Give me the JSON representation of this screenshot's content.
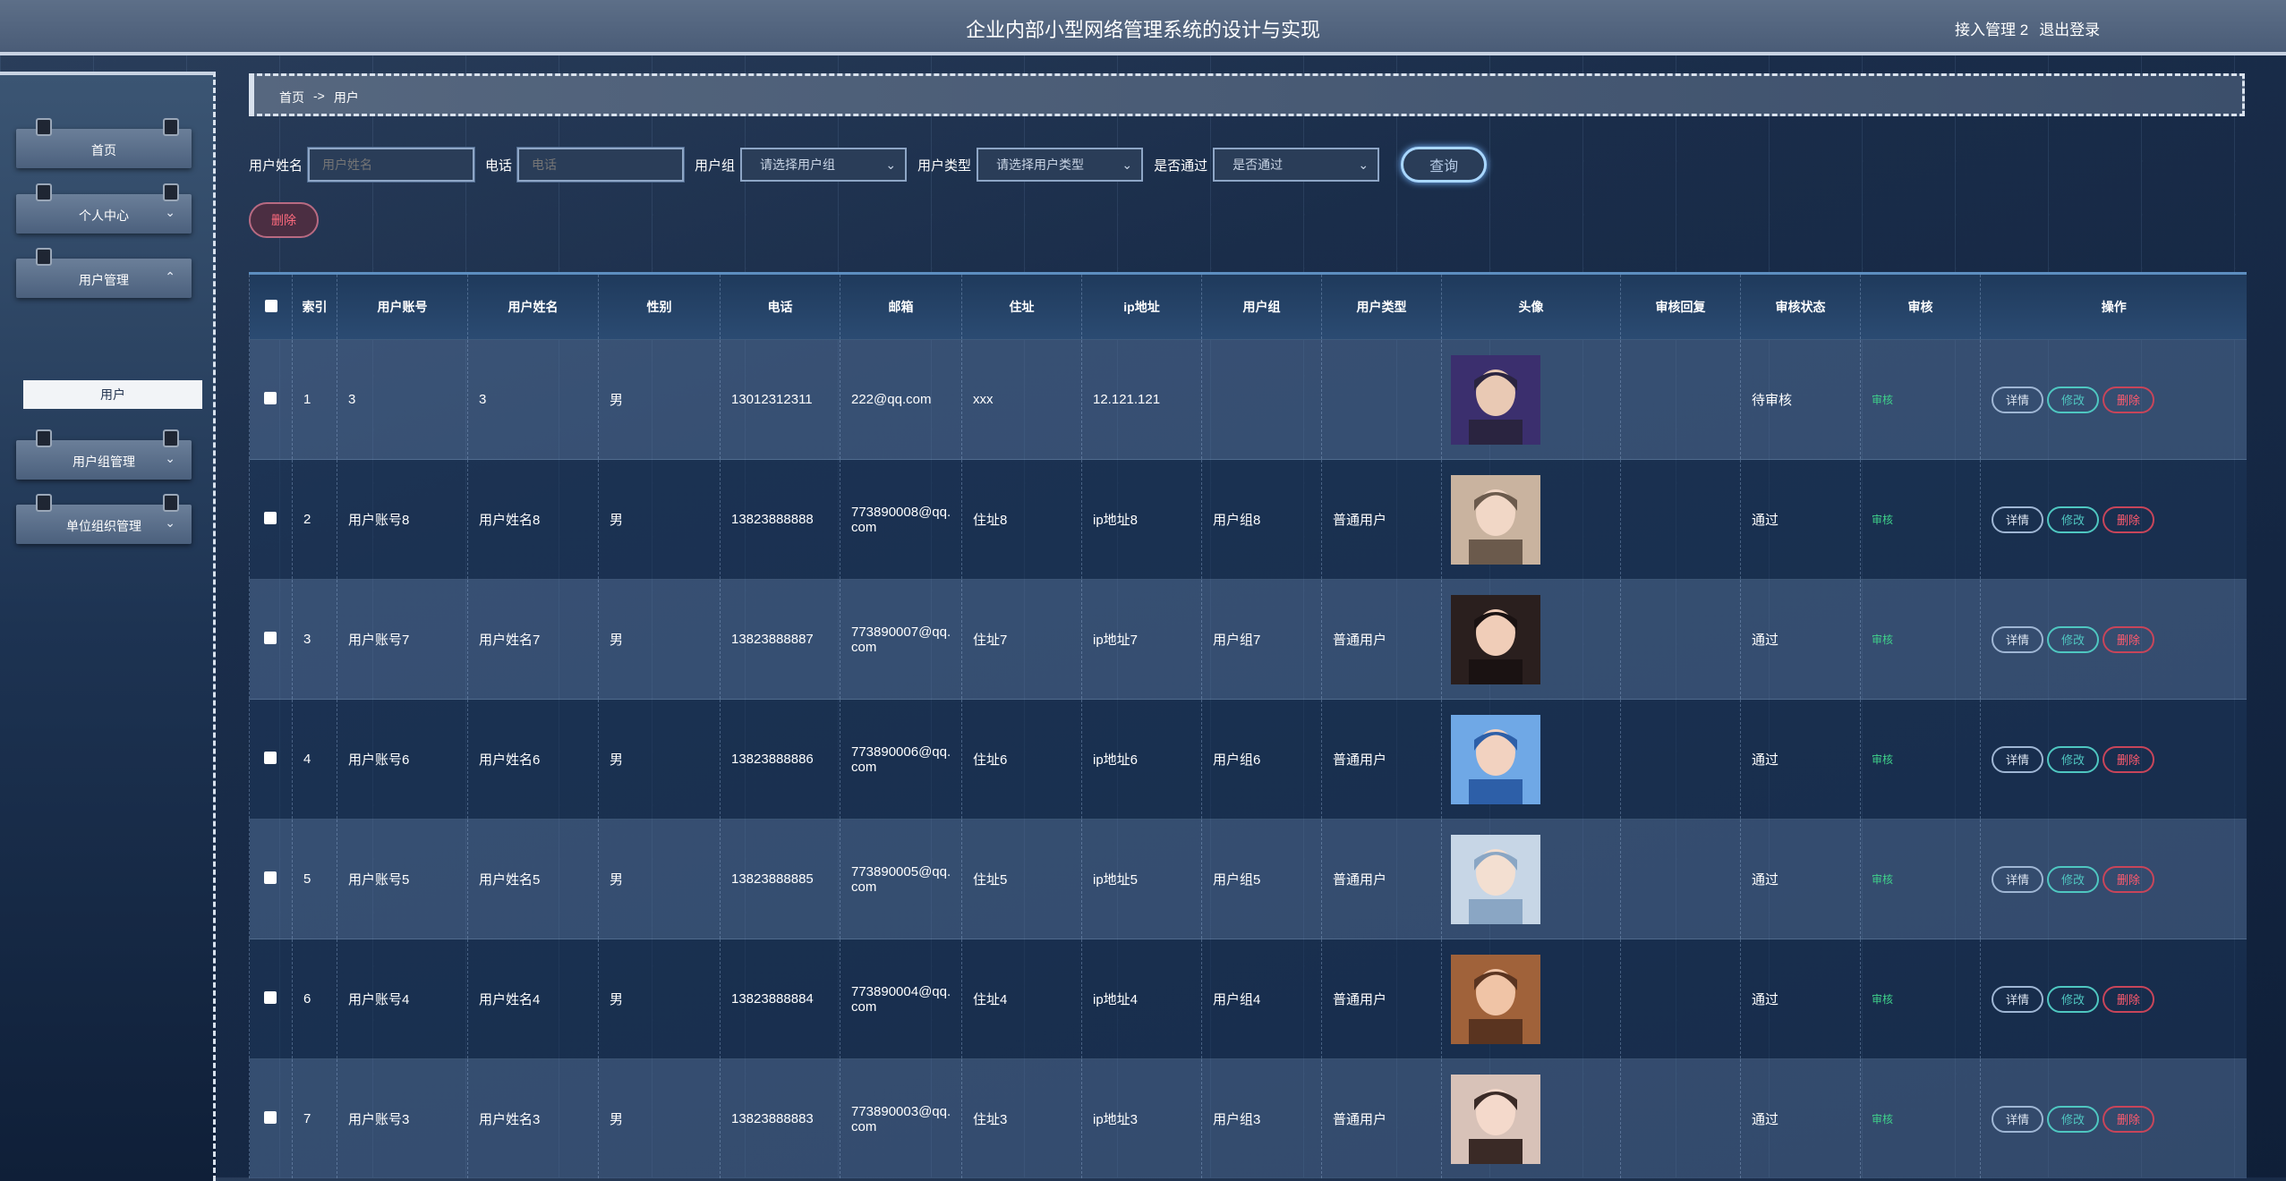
{
  "header": {
    "title": "企业内部小型网络管理系统的设计与实现",
    "user_label": "接入管理 2",
    "logout_label": "退出登录"
  },
  "sidebar": {
    "items": [
      {
        "label": "首页",
        "chevron": ""
      },
      {
        "label": "个人中心",
        "chevron": "⌄"
      },
      {
        "label": "用户管理",
        "chevron": "⌃"
      },
      {
        "label": "用户组管理",
        "chevron": "⌄"
      },
      {
        "label": "单位组织管理",
        "chevron": "⌄"
      }
    ],
    "submenu_active": "用户"
  },
  "breadcrumb": {
    "home": "首页",
    "sep": "->",
    "current": "用户"
  },
  "search": {
    "name_label": "用户姓名",
    "name_placeholder": "用户姓名",
    "phone_label": "电话",
    "phone_placeholder": "电话",
    "group_label": "用户组",
    "group_value": "请选择用户组",
    "type_label": "用户类型",
    "type_value": "请选择用户类型",
    "pass_label": "是否通过",
    "pass_value": "是否通过",
    "query_button": "查询",
    "delete_button": "删除"
  },
  "table": {
    "headers": [
      "",
      "索引",
      "用户账号",
      "用户姓名",
      "性别",
      "电话",
      "邮箱",
      "住址",
      "ip地址",
      "用户组",
      "用户类型",
      "头像",
      "审核回复",
      "审核状态",
      "审核",
      "操作"
    ],
    "ops": {
      "detail": "详情",
      "edit": "修改",
      "delete": "删除"
    },
    "audit_link": "审核",
    "rows": [
      {
        "index": "1",
        "account": "3",
        "name": "3",
        "gender": "男",
        "phone": "13012312311",
        "email": "222@qq.com",
        "address": "xxx",
        "ip": "12.121.121",
        "group": "",
        "type": "",
        "reply": "",
        "status": "待审核"
      },
      {
        "index": "2",
        "account": "用户账号8",
        "name": "用户姓名8",
        "gender": "男",
        "phone": "13823888888",
        "email": "773890008@qq.com",
        "address": "住址8",
        "ip": "ip地址8",
        "group": "用户组8",
        "type": "普通用户",
        "reply": "",
        "status": "通过"
      },
      {
        "index": "3",
        "account": "用户账号7",
        "name": "用户姓名7",
        "gender": "男",
        "phone": "13823888887",
        "email": "773890007@qq.com",
        "address": "住址7",
        "ip": "ip地址7",
        "group": "用户组7",
        "type": "普通用户",
        "reply": "",
        "status": "通过"
      },
      {
        "index": "4",
        "account": "用户账号6",
        "name": "用户姓名6",
        "gender": "男",
        "phone": "13823888886",
        "email": "773890006@qq.com",
        "address": "住址6",
        "ip": "ip地址6",
        "group": "用户组6",
        "type": "普通用户",
        "reply": "",
        "status": "通过"
      },
      {
        "index": "5",
        "account": "用户账号5",
        "name": "用户姓名5",
        "gender": "男",
        "phone": "13823888885",
        "email": "773890005@qq.com",
        "address": "住址5",
        "ip": "ip地址5",
        "group": "用户组5",
        "type": "普通用户",
        "reply": "",
        "status": "通过"
      },
      {
        "index": "6",
        "account": "用户账号4",
        "name": "用户姓名4",
        "gender": "男",
        "phone": "13823888884",
        "email": "773890004@qq.com",
        "address": "住址4",
        "ip": "ip地址4",
        "group": "用户组4",
        "type": "普通用户",
        "reply": "",
        "status": "通过"
      },
      {
        "index": "7",
        "account": "用户账号3",
        "name": "用户姓名3",
        "gender": "男",
        "phone": "13823888883",
        "email": "773890003@qq.com",
        "address": "住址3",
        "ip": "ip地址3",
        "group": "用户组3",
        "type": "普通用户",
        "reply": "",
        "status": "通过"
      }
    ]
  },
  "colors": {
    "accent": "#a9d7ff",
    "audit": "#3fd18a",
    "edit": "#4fc7c1",
    "delete": "#ff5a6e"
  }
}
